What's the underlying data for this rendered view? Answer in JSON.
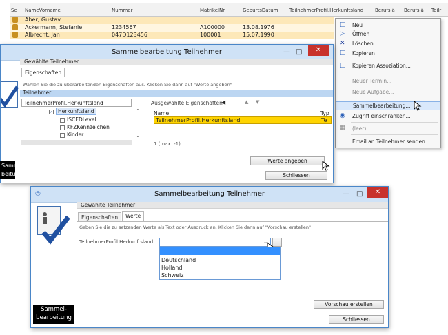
{
  "grid": {
    "columns": [
      "Se",
      "NameVorname",
      "Nummer",
      "MatrikelNr",
      "GeburtsDatum",
      "TeilnehmerProfil.Herkunftsland",
      "Berufslä",
      "Berufslä",
      "Teilr"
    ],
    "rows": [
      {
        "name": "Aber, Gustav",
        "nummer": "",
        "matrikel": "",
        "geburt": ""
      },
      {
        "name": "Ackermann, Stefanie",
        "nummer": "1234567",
        "matrikel": "A100000",
        "geburt": "13.08.1976"
      },
      {
        "name": "Albrecht, Jan",
        "nummer": "047D123456",
        "matrikel": "100001",
        "geburt": "15.07.1990"
      }
    ]
  },
  "context_menu": {
    "items": [
      {
        "label": "Neu",
        "icon": "new-doc-icon",
        "enabled": true
      },
      {
        "label": "Öffnen",
        "icon": "open-icon",
        "enabled": true
      },
      {
        "label": "Löschen",
        "icon": "delete-x-icon",
        "enabled": true
      },
      {
        "label": "Kopieren",
        "icon": "copy-icon",
        "enabled": true
      },
      {
        "label": "Kopieren Assoziation...",
        "icon": "copy-assoc-icon",
        "enabled": true
      },
      {
        "label": "Neuer Termin...",
        "icon": "",
        "enabled": false
      },
      {
        "label": "Neue Aufgabe...",
        "icon": "",
        "enabled": false
      },
      {
        "label": "Sammelbearbeitung...",
        "icon": "",
        "enabled": true,
        "highlighted": true
      },
      {
        "label": "Zugriff einschränken...",
        "icon": "access-icon",
        "enabled": true
      },
      {
        "label": "(leer)",
        "icon": "clipboard-icon",
        "enabled": false
      },
      {
        "label": "Email an Teilnehmer senden...",
        "icon": "",
        "enabled": true
      }
    ]
  },
  "dialog1": {
    "title": "Sammelbearbeitung Teilnehmer",
    "section": "Gewählte Teilnehmer",
    "tab": "Eigenschaften",
    "hint": "Wählen Sie die zu überarbeitenden Eigenschaften aus. Klicken Sie dann auf \"Werte angeben\"",
    "group": "Teilnehmer",
    "tree_root": "TeilnehmerProfil.Herkunftsland",
    "tree_items": [
      {
        "label": "Herkunftsland",
        "checked": true
      },
      {
        "label": "ISCEDLevel",
        "checked": false
      },
      {
        "label": "KFZKennzeichen",
        "checked": false
      },
      {
        "label": "Kinder",
        "checked": false
      }
    ],
    "selected_header": "Ausgewählte Eigenschaften",
    "col_name": "Name",
    "col_typ": "Typ",
    "selected_row": "TeilnehmerProfil.Herkunftsland",
    "selected_row_typ": "Te",
    "count": "1 (max. -1)",
    "btn_values": "Werte angeben",
    "btn_close": "Schliessen",
    "side_label": "Sammel-\nbeitung"
  },
  "dialog2": {
    "title": "Sammelbearbeitung Teilnehmer",
    "section": "Gewählte Teilnehmer",
    "tab1": "Eigenschaften",
    "tab2": "Werte",
    "hint": "Geben Sie die zu setzenden Werte als Text oder Ausdruck an. Klicken Sie dann auf \"Vorschau erstellen\"",
    "field_label": "TeilnehmerProfil.Herkunftsland",
    "dropdown_options": [
      "",
      "Deutschland",
      "Holland",
      "Schweiz"
    ],
    "btn_ellipsis": "...",
    "btn_preview": "Vorschau erstellen",
    "btn_close": "Schliessen",
    "side_label_1": "Sammel-",
    "side_label_2": "bearbeitung"
  },
  "colors": {
    "accent": "#4a86c8",
    "selection": "#ffd400",
    "close": "#c8322c"
  }
}
